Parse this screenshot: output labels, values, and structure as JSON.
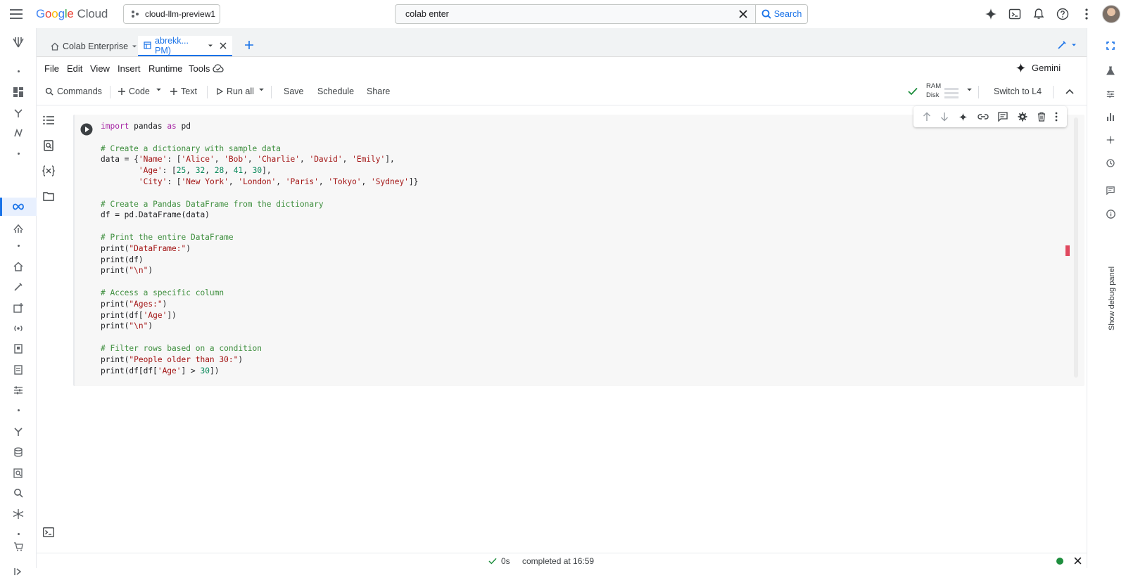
{
  "topbar": {
    "logo_google": "Google",
    "logo_cloud": "Cloud",
    "project": "cloud-llm-preview1",
    "search_value": "colab enter",
    "search_button": "Search"
  },
  "tabs": [
    {
      "label": "Colab Enterprise"
    },
    {
      "label": "abrekk... PM)"
    }
  ],
  "menu": {
    "items": [
      "File",
      "Edit",
      "View",
      "Insert",
      "Runtime",
      "Tools"
    ],
    "gemini": "Gemini"
  },
  "toolbar": {
    "commands": "Commands",
    "code": "Code",
    "text": "Text",
    "run_all": "Run all",
    "save": "Save",
    "schedule": "Schedule",
    "share": "Share",
    "ram": "RAM",
    "disk": "Disk",
    "switch": "Switch to L4"
  },
  "cell": {
    "language": "python"
  },
  "right_panel": {
    "debug_label": "Show debug panel"
  },
  "status": {
    "duration": "0s",
    "completed": "completed at 16:59"
  },
  "colors": {
    "accent": "#1a73e8",
    "success": "#1e8e3e",
    "error_marker": "#e0495f"
  }
}
